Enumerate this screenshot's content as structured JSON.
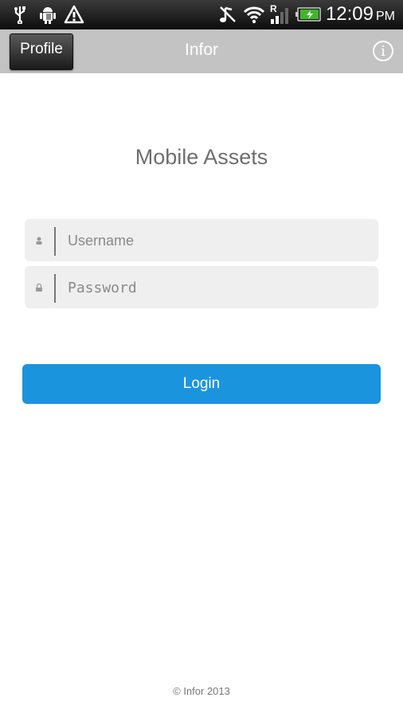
{
  "status_bar": {
    "time": "12:09",
    "ampm": "PM",
    "left_icons": [
      "usb-icon",
      "android-debug-icon",
      "warning-icon"
    ],
    "right_icons": [
      "music-muted-icon",
      "wifi-icon",
      "roaming-signal-icon",
      "battery-charging-icon"
    ],
    "roaming_label": "R"
  },
  "navbar": {
    "profile_label": "Profile",
    "title": "Infor",
    "info_label": "i"
  },
  "login": {
    "app_title": "Mobile Assets",
    "username": {
      "value": "",
      "placeholder": "Username"
    },
    "password": {
      "value": "",
      "placeholder": "Password"
    },
    "button_label": "Login"
  },
  "footer": {
    "copyright": "© Infor 2013"
  },
  "colors": {
    "navbar_bg": "#c3c3c3",
    "login_button": "#1b94de",
    "field_bg": "#efefef"
  }
}
